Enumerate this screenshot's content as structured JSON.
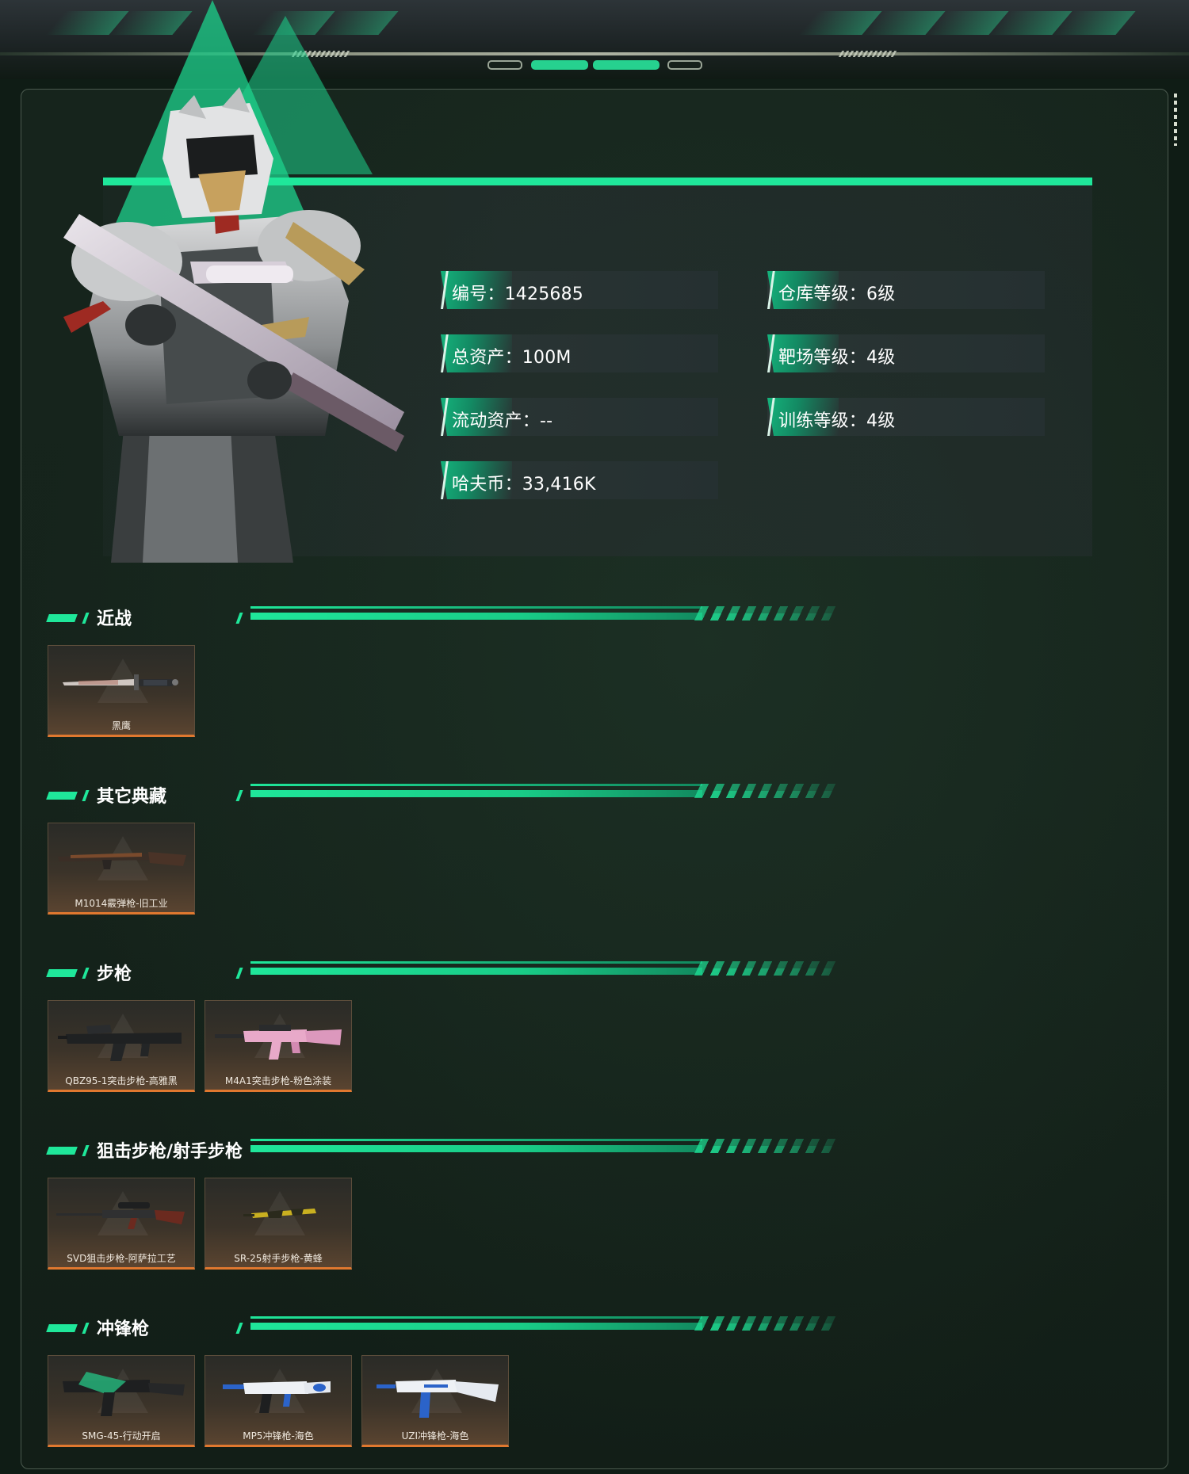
{
  "profile": {
    "stats": [
      {
        "label": "编号：1425685"
      },
      {
        "label": "仓库等级：6级"
      },
      {
        "label": "总资产：100M"
      },
      {
        "label": "靶场等级：4级"
      },
      {
        "label": "流动资产：--"
      },
      {
        "label": "训练等级：4级"
      },
      {
        "label": "哈夫币：33,416K"
      }
    ]
  },
  "sections": [
    {
      "title": "近战",
      "items": [
        {
          "name": "黑鹰",
          "icon": "knife-icon"
        }
      ]
    },
    {
      "title": "其它典藏",
      "items": [
        {
          "name": "M1014霰弹枪-旧工业",
          "icon": "shotgun-icon"
        }
      ]
    },
    {
      "title": "步枪",
      "items": [
        {
          "name": "QBZ95-1突击步枪-高雅黑",
          "icon": "bullpup-rifle-icon"
        },
        {
          "name": "M4A1突击步枪-粉色涂装",
          "icon": "pink-rifle-icon"
        }
      ]
    },
    {
      "title": "狙击步枪/射手步枪",
      "items": [
        {
          "name": "SVD狙击步枪-阿萨拉工艺",
          "icon": "sniper-rifle-icon"
        },
        {
          "name": "SR-25射手步枪-黄蜂",
          "icon": "yellow-rifle-icon"
        }
      ]
    },
    {
      "title": "冲锋枪",
      "items": [
        {
          "name": "SMG-45-行动开启",
          "icon": "green-smg-icon"
        },
        {
          "name": "MP5冲锋枪-海色",
          "icon": "white-smg-icon"
        },
        {
          "name": "UZI冲锋枪-海色",
          "icon": "white-uzi-icon"
        }
      ]
    }
  ],
  "colors": {
    "accent": "#1fe79a",
    "card_border": "#e0782f",
    "panel_bg": "#15231b"
  }
}
